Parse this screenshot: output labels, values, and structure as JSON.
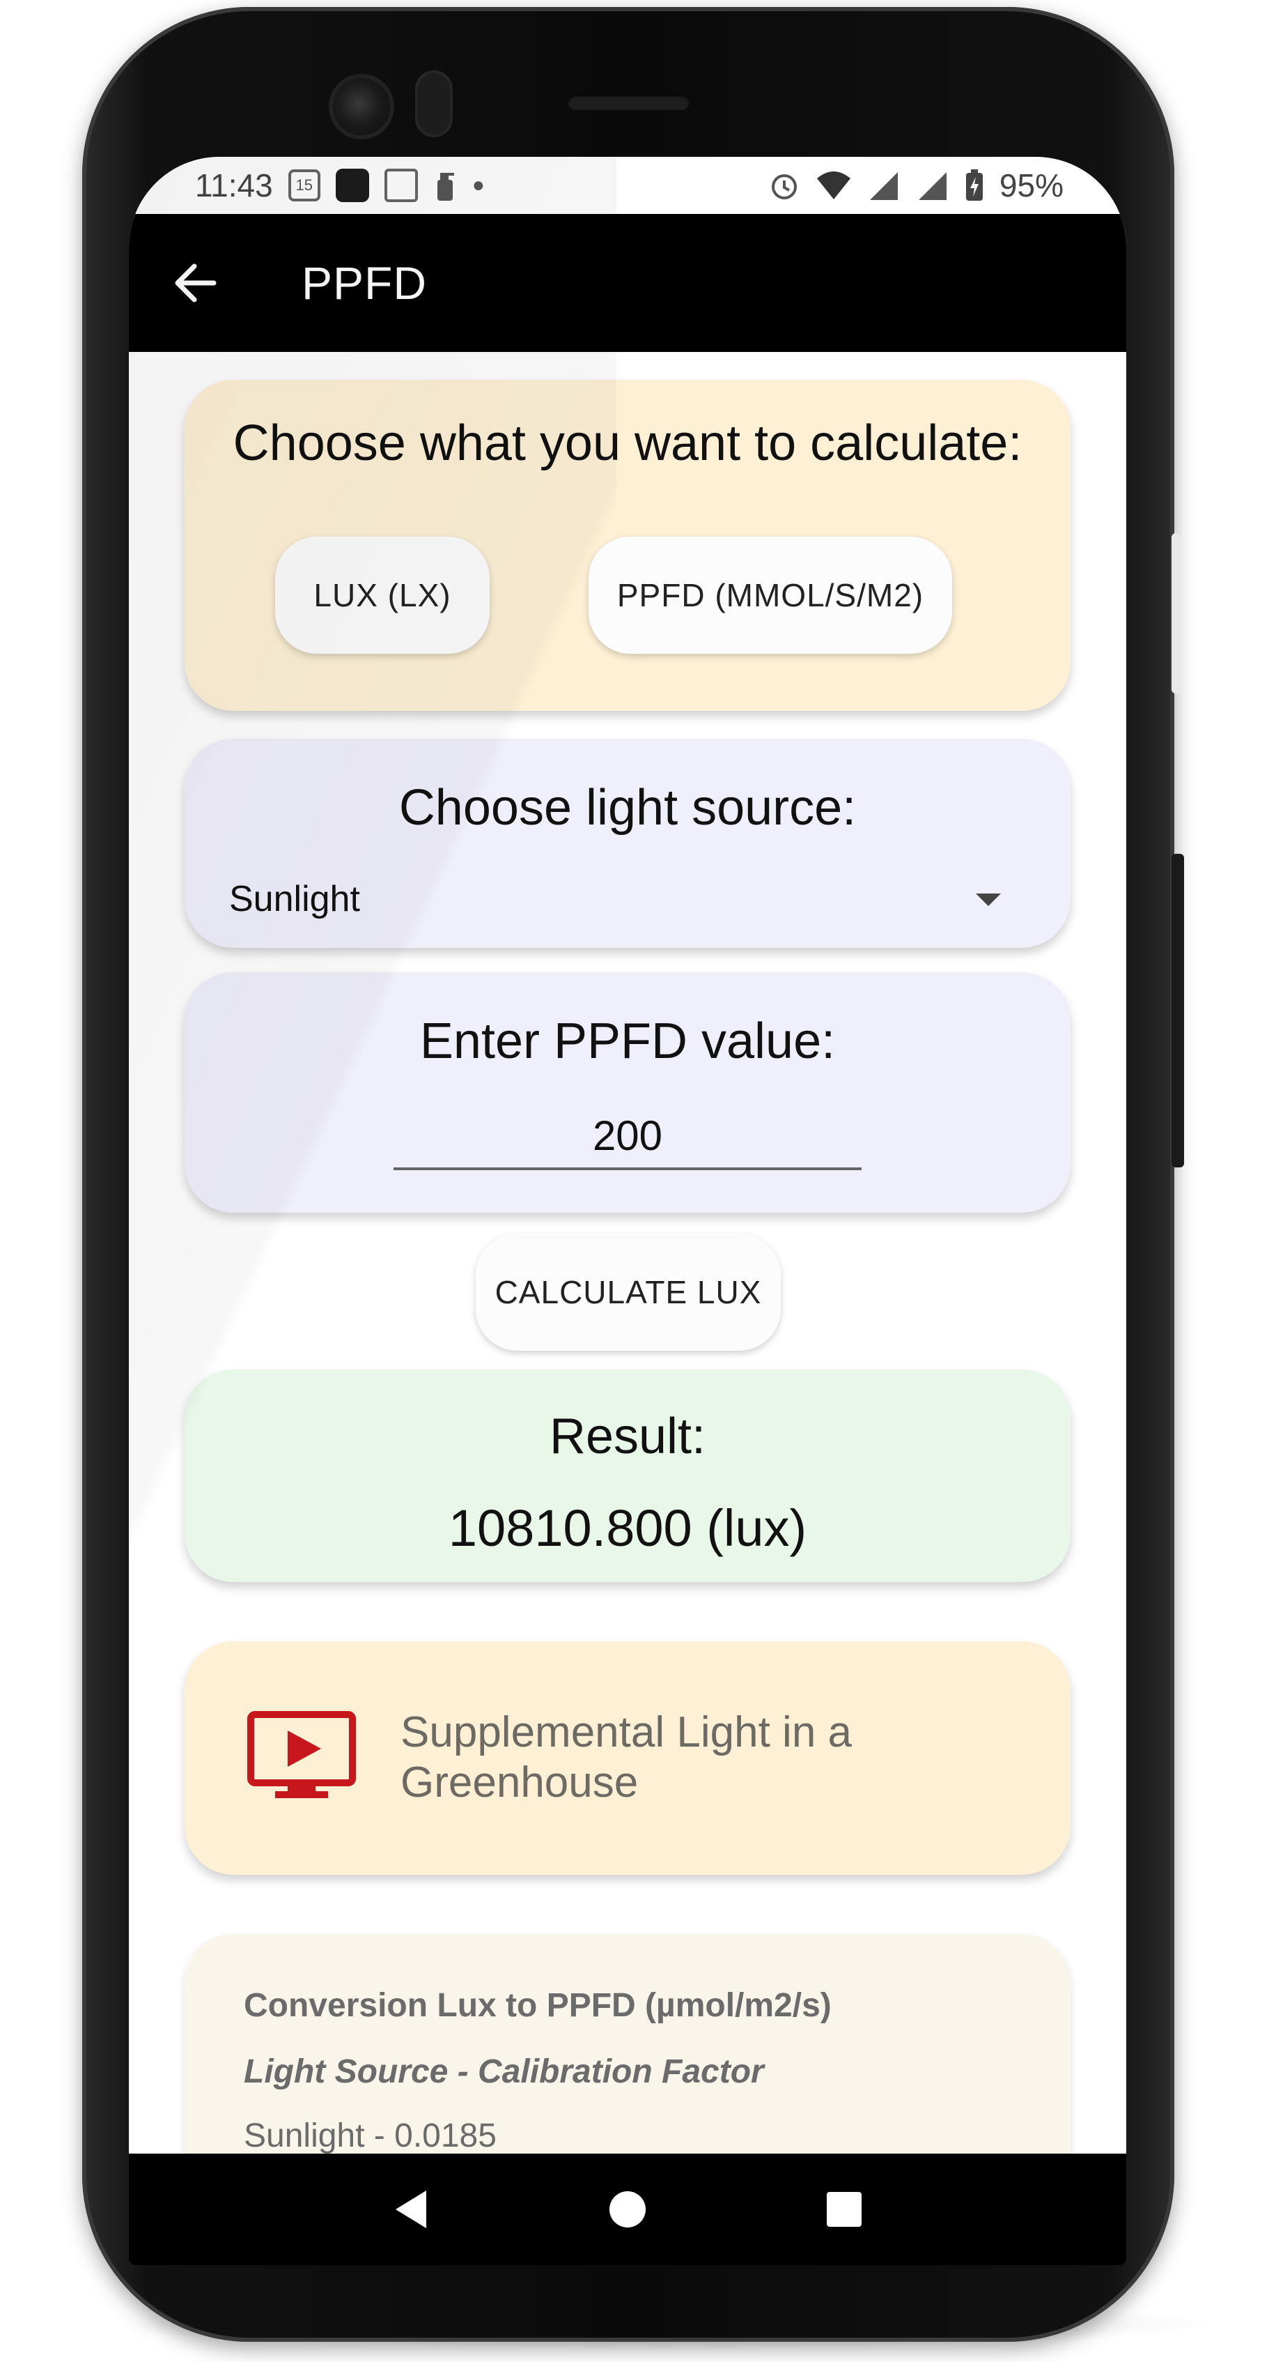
{
  "status_bar": {
    "time": "11:43",
    "calendar_day": "15",
    "battery": "95%"
  },
  "app_bar": {
    "title": "PPFD"
  },
  "calc_choice": {
    "heading": "Choose what you want to calculate:",
    "option_lux": "LUX (LX)",
    "option_ppfd": "PPFD (MMOL/S/M2)"
  },
  "light_source": {
    "heading": "Choose light source:",
    "selected": "Sunlight"
  },
  "ppfd_input": {
    "heading": "Enter PPFD value:",
    "value": "200"
  },
  "calculate_button": "CALCULATE LUX",
  "result": {
    "heading": "Result:",
    "value": "10810.800 (lux)"
  },
  "video_card": {
    "line1": "Supplemental Light in a",
    "line2": "Greenhouse",
    "icon": "video-play-icon",
    "icon_color": "#c8161d"
  },
  "conversion_note": {
    "title": "Conversion Lux to PPFD (µmol/m2/s)",
    "subtitle": "Light Source - Calibration Factor",
    "first_entry": "Sunlight - 0.0185"
  },
  "colors": {
    "yellow_card": "#fdf0d5",
    "lavender_card": "#efeefb",
    "green_card": "#e8f7e7",
    "app_bar": "#000000"
  }
}
